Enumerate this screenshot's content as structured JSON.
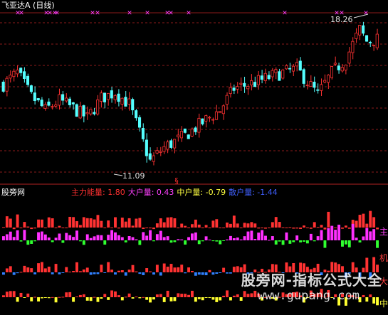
{
  "main": {
    "title": "飞亚达A (日线)",
    "high_label": "18.26",
    "low_label": "11.09",
    "marker_glyph": "§",
    "star_glyph": "✕"
  },
  "indicator": {
    "name": "股旁网",
    "legend": [
      {
        "label": "主力能量: ",
        "value": "1.80",
        "color": "#ff3030"
      },
      {
        "label": "大户量: ",
        "value": "0.43",
        "color": "#ff40ff"
      },
      {
        "label": "中户量: ",
        "value": "-0.79",
        "color": "#ffff40"
      },
      {
        "label": "散户量: ",
        "value": "-1.44",
        "color": "#4060ff"
      }
    ],
    "side_labels": [
      {
        "text": "主",
        "color": "#ff40ff"
      },
      {
        "text": "机",
        "color": "#ff4040"
      },
      {
        "text": "大",
        "color": "#ff4040"
      },
      {
        "text": "中",
        "color": "#ffff40"
      }
    ]
  },
  "watermark": {
    "text": "股旁网-指标公式大全",
    "url": "www.gupang.com"
  },
  "colors": {
    "up": "#ff3232",
    "down": "#54ffff",
    "grid": "#8b1a1a",
    "green": "#30ff30",
    "magenta": "#ff30ff",
    "yellow": "#ffff30",
    "blue": "#3080ff"
  }
}
